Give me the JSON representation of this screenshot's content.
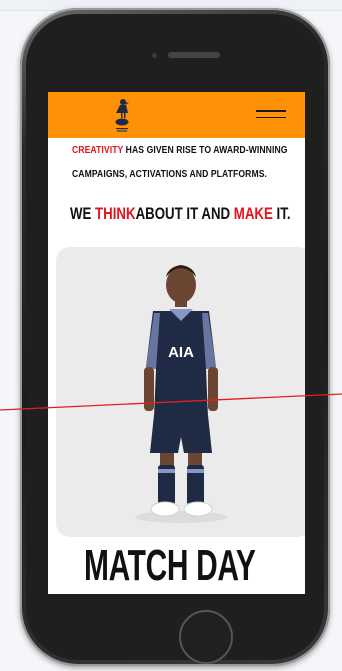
{
  "header": {
    "logo": "club-crest-icon",
    "menu_icon": "hamburger-menu-icon"
  },
  "intro": {
    "line1_accent": "CREATIVITY",
    "line1_rest": " HAS GIVEN RISE TO AWARD-WINNING",
    "line2": "CAMPAIGNS, ACTIVATIONS AND PLATFORMS."
  },
  "headline": {
    "we": "WE ",
    "think": "THINK",
    "about": "ABOUT IT AND ",
    "make": "MAKE",
    "it": " IT."
  },
  "hero": {
    "image": "child-in-navy-football-kit",
    "sponsor_text": "AIA"
  },
  "section_title": "MATCH DAY",
  "colors": {
    "header_bg": "#ff9106",
    "accent": "#e8121d",
    "text": "#111111",
    "kit_navy": "#1f2a44"
  }
}
